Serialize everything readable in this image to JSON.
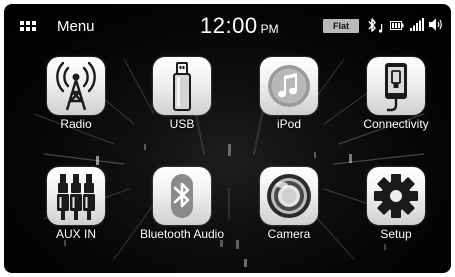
{
  "header": {
    "menu_label": "Menu",
    "time": "12:00",
    "ampm": "PM",
    "eq_badge": "Flat"
  },
  "icons": {
    "menu": "grid-icon",
    "bluetooth": "bluetooth-icon",
    "battery": "battery-icon",
    "signal": "signal-icon",
    "volume": "volume-icon"
  },
  "apps": [
    {
      "label": "Radio",
      "icon": "radio-tower-icon"
    },
    {
      "label": "USB",
      "icon": "usb-drive-icon"
    },
    {
      "label": "iPod",
      "icon": "music-note-icon"
    },
    {
      "label": "Connectivity",
      "icon": "phone-connect-icon"
    },
    {
      "label": "AUX IN",
      "icon": "rca-plugs-icon"
    },
    {
      "label": "Bluetooth Audio",
      "icon": "bluetooth-icon"
    },
    {
      "label": "Camera",
      "icon": "camera-lens-icon"
    },
    {
      "label": "Setup",
      "icon": "gear-icon"
    }
  ],
  "colors": {
    "background": "#000000",
    "tile": "#f0f0f0",
    "icon": "#1a1a1a",
    "text": "#ffffff"
  }
}
